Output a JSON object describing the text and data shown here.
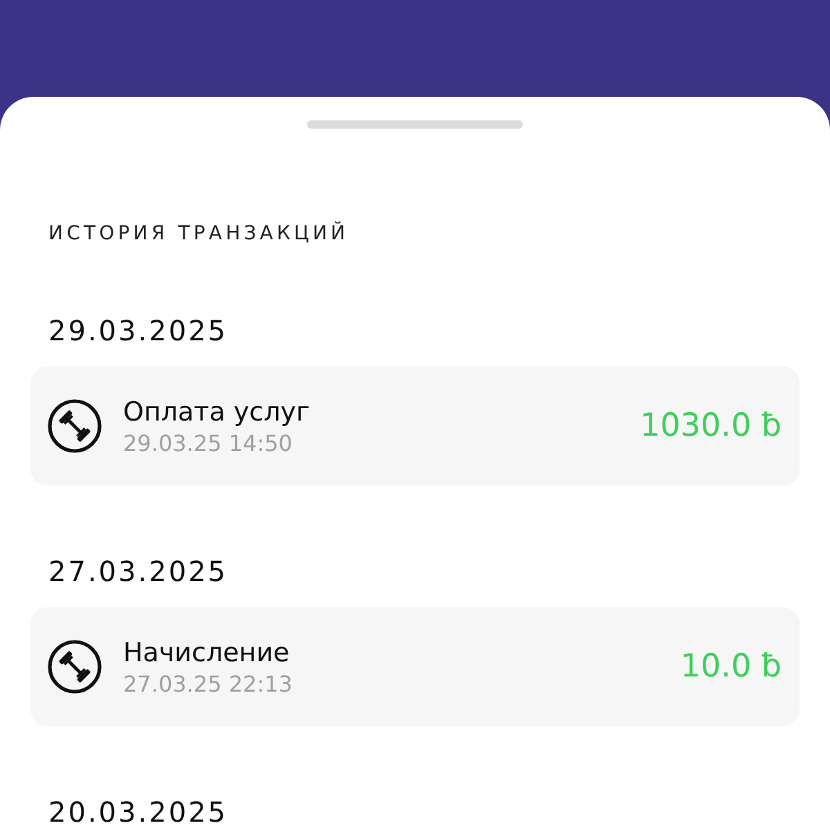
{
  "title": "ИСТОРИЯ ТРАНЗАКЦИЙ",
  "groups": [
    {
      "date": "29.03.2025",
      "transactions": [
        {
          "name": "Оплата услуг",
          "time": "29.03.25 14:50",
          "amount": "1030.0 ƀ"
        }
      ]
    },
    {
      "date": "27.03.2025",
      "transactions": [
        {
          "name": "Начисление",
          "time": "27.03.25 22:13",
          "amount": "10.0 ƀ"
        }
      ]
    },
    {
      "date": "20.03.2025"
    }
  ]
}
